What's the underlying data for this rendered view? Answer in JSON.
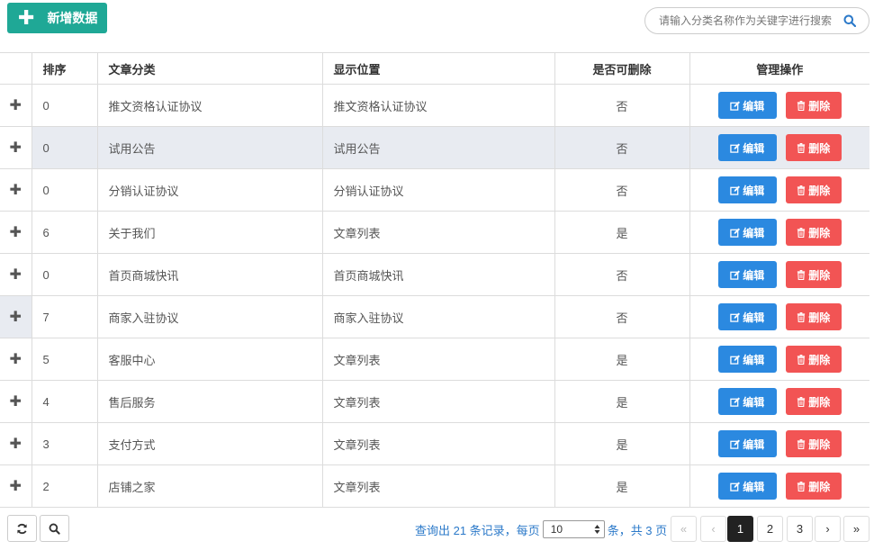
{
  "toolbar": {
    "add_label": "新增数据"
  },
  "search": {
    "placeholder": "请输入分类名称作为关键字进行搜索"
  },
  "table": {
    "headers": [
      "排序",
      "文章分类",
      "显示位置",
      "是否可删除",
      "管理操作"
    ],
    "rows": [
      {
        "sort": "0",
        "category": "推文资格认证协议",
        "position": "推文资格认证协议",
        "deletable": "否"
      },
      {
        "sort": "0",
        "category": "试用公告",
        "position": "试用公告",
        "deletable": "否"
      },
      {
        "sort": "0",
        "category": "分销认证协议",
        "position": "分销认证协议",
        "deletable": "否"
      },
      {
        "sort": "6",
        "category": "关于我们",
        "position": "文章列表",
        "deletable": "是"
      },
      {
        "sort": "0",
        "category": "首页商城快讯",
        "position": "首页商城快讯",
        "deletable": "否"
      },
      {
        "sort": "7",
        "category": "商家入驻协议",
        "position": "商家入驻协议",
        "deletable": "否"
      },
      {
        "sort": "5",
        "category": "客服中心",
        "position": "文章列表",
        "deletable": "是"
      },
      {
        "sort": "4",
        "category": "售后服务",
        "position": "文章列表",
        "deletable": "是"
      },
      {
        "sort": "3",
        "category": "支付方式",
        "position": "文章列表",
        "deletable": "是"
      },
      {
        "sort": "2",
        "category": "店铺之家",
        "position": "文章列表",
        "deletable": "是"
      }
    ],
    "edit_label": "编辑",
    "delete_label": "删除",
    "expand_symbol": "✚"
  },
  "pagination": {
    "info_prefix": "查询出 21 条记录，每页",
    "page_size": "10",
    "info_suffix": "条，共 3 页",
    "first": "«",
    "prev": "‹",
    "pages": [
      "1",
      "2",
      "3"
    ],
    "current_page": "1",
    "next": "›",
    "last": "»"
  },
  "colors": {
    "add_button": "#1fa896",
    "edit_button": "#2b89e0",
    "delete_button": "#f25454",
    "pager_text": "#2b79c9",
    "row_highlight": "#e8ebf1"
  },
  "icons": {
    "add": "plus-icon",
    "search": "search-icon",
    "edit": "edit-icon",
    "delete": "trash-icon",
    "refresh": "refresh-icon",
    "footer_search": "search-icon"
  }
}
